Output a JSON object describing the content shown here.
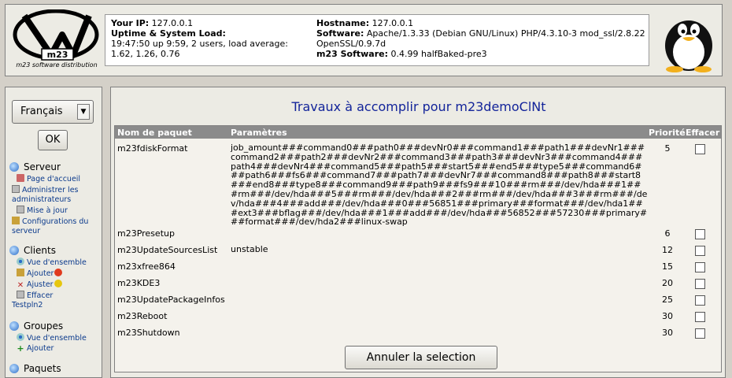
{
  "header": {
    "logo_caption": "m23 software distribution",
    "ip_label": "Your IP:",
    "ip_value": "127.0.0.1",
    "uptime_label": "Uptime & System Load:",
    "uptime_value": "19:47:50 up 9:59, 2 users, load average: 1.62, 1.26, 0.76",
    "hostname_label": "Hostname:",
    "hostname_value": "127.0.0.1",
    "software_label": "Software:",
    "software_value": "Apache/1.3.33 (Debian GNU/Linux) PHP/4.3.10-3 mod_ssl/2.8.22 OpenSSL/0.9.7d",
    "m23_label": "m23 Software:",
    "m23_value": "0.4.99 halfBaked-pre3"
  },
  "sidebar": {
    "language": "Français",
    "ok": "OK",
    "server": {
      "title": "Serveur",
      "links": [
        "Page d'accueil",
        "Administrer les administrateurs",
        "Mise à jour",
        "Configurations du serveur"
      ]
    },
    "clients": {
      "title": "Clients",
      "links": [
        "Vue d'ensemble",
        "Ajouter",
        "Ajuster",
        "Effacer",
        "Testpln2"
      ]
    },
    "groups": {
      "title": "Groupes",
      "links": [
        "Vue d'ensemble",
        "Ajouter"
      ]
    },
    "packages": {
      "title": "Paquets"
    }
  },
  "main": {
    "title": "Travaux à accomplir pour m23demoClNt",
    "columns": {
      "name": "Nom de paquet",
      "params": "Paramètres",
      "priority": "Priorité",
      "delete": "Effacer"
    },
    "rows": [
      {
        "name": "m23fdiskFormat",
        "params": "job_amount###command0###path0###devNr0###command1###path1###devNr1###command2###path2###devNr2###command3###path3###devNr3###command4###path4###devNr4###command5###path5###start5###end5###type5###command6###path6###fs6###command7###path7###devNr7###command8###path8###start8###end8###type8###command9###path9###fs9###10###rm###/dev/hda###1###rm###/dev/hda###5###rm###/dev/hda###2###rm###/dev/hda###3###rm###/dev/hda###4###add###/dev/hda###0###56851###primary###format###/dev/hda1###ext3###bflag###/dev/hda###1###add###/dev/hda###56852###57230###primary###format###/dev/hda2###linux-swap",
        "priority": "5"
      },
      {
        "name": "m23Presetup",
        "params": "",
        "priority": "6"
      },
      {
        "name": "m23UpdateSourcesList",
        "params": "unstable",
        "priority": "12"
      },
      {
        "name": "m23xfree864",
        "params": "",
        "priority": "15"
      },
      {
        "name": "m23KDE3",
        "params": "",
        "priority": "20"
      },
      {
        "name": "m23UpdatePackageInfos",
        "params": "",
        "priority": "25"
      },
      {
        "name": "m23Reboot",
        "params": "",
        "priority": "30"
      },
      {
        "name": "m23Shutdown",
        "params": "",
        "priority": "30"
      }
    ],
    "cancel_button": "Annuler la selection"
  }
}
